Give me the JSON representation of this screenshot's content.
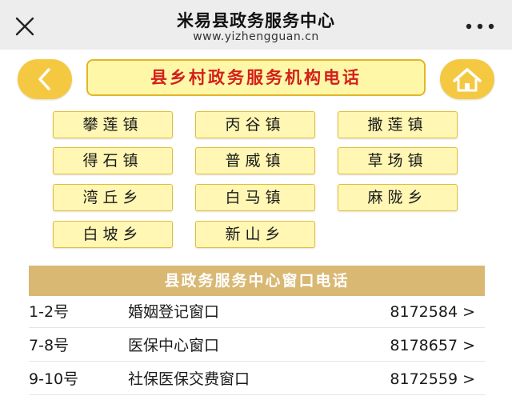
{
  "header": {
    "title": "米易县政务服务中心",
    "url": "www.yizhengguan.cn",
    "close_icon": "close-icon",
    "more_icon": "more-icon"
  },
  "nav": {
    "back_icon": "chevron-left-icon",
    "home_icon": "home-icon",
    "banner_title": "县乡村政务服务机构电话"
  },
  "towns": [
    "攀莲镇",
    "丙谷镇",
    "撒莲镇",
    "得石镇",
    "普威镇",
    "草场镇",
    "湾丘乡",
    "白马镇",
    "麻陇乡",
    "白坡乡",
    "新山乡"
  ],
  "section": {
    "title": "县政务服务中心窗口电话"
  },
  "windows": [
    {
      "num": "1-2号",
      "name": "婚姻登记窗口",
      "phone": "8172584 >"
    },
    {
      "num": "7-8号",
      "name": "医保中心窗口",
      "phone": "8178657 >"
    },
    {
      "num": "9-10号",
      "name": "社保医保交费窗口",
      "phone": "8172559 >"
    }
  ],
  "colors": {
    "accent_gold": "#f5c842",
    "banner_bg": "#fff7a8",
    "banner_text": "#d3201a",
    "section_bg": "#d9b873"
  }
}
